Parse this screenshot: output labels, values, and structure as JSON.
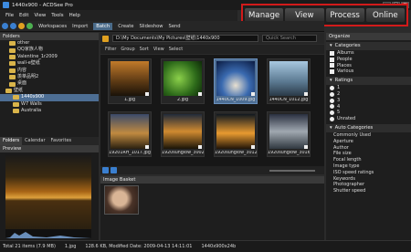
{
  "window": {
    "title": "1440x900 - ACDSee Pro",
    "buttons": [
      "_",
      "□",
      "×"
    ]
  },
  "menu": [
    "File",
    "Edit",
    "View",
    "Tools",
    "Help"
  ],
  "modes": [
    "Manage",
    "View",
    "Process",
    "Online"
  ],
  "toolbar": {
    "workspaces": "Workspaces",
    "import": "Import",
    "batch": "Batch",
    "create": "Create",
    "slideshow": "Slideshow",
    "send": "Send"
  },
  "folders": {
    "title": "Folders",
    "items": [
      "other",
      "QQ家族人物",
      "Valentine_1r2009",
      "wall-e壁纸",
      "内容",
      "羡莘品明2",
      "桌面",
      "壁纸",
      "1440x900",
      "W7 Walls",
      "Australia"
    ],
    "selected_index": 8
  },
  "left_tabs": [
    "Folders",
    "Calendar",
    "Favorites"
  ],
  "preview": {
    "title": "Preview"
  },
  "address": {
    "path": "D:\\My Documents\\My Pictures\\壁纸\\1440x900",
    "quick_search": "Quick Search"
  },
  "filter": [
    "Filter",
    "Group",
    "Sort",
    "View",
    "Select"
  ],
  "thumbs": [
    "1.jpg",
    "2.jpg",
    "1440CN_1009.jpg",
    "1440CN_1012.jpg",
    "19201RH_1017.jpg",
    "1920sunglow_3002.jpg",
    "1920sunglow_3012.jpg",
    "1920sunglow_3016.jpg"
  ],
  "selected_thumb": 2,
  "basket": {
    "title": "Image Basket"
  },
  "organize": {
    "title": "Organize",
    "categories": {
      "title": "Categories",
      "items": [
        "Albums",
        "People",
        "Places",
        "Various"
      ]
    },
    "ratings": {
      "title": "Ratings",
      "items": [
        "1",
        "2",
        "3",
        "4",
        "5",
        "Unrated"
      ]
    },
    "auto": {
      "title": "Auto Categories",
      "items": [
        "Commonly Used",
        "Aperture",
        "Author",
        "File size",
        "Focal length",
        "Image type",
        "ISO speed ratings",
        "Keywords",
        "Photographer",
        "Shutter speed"
      ]
    }
  },
  "status": {
    "total": "Total 21 items (7.9 MB)",
    "file": "1.jpg",
    "info": "128.6 KB, Modified Date: 2009-04-13 14:11:01",
    "dims": "1440x900x24b"
  }
}
